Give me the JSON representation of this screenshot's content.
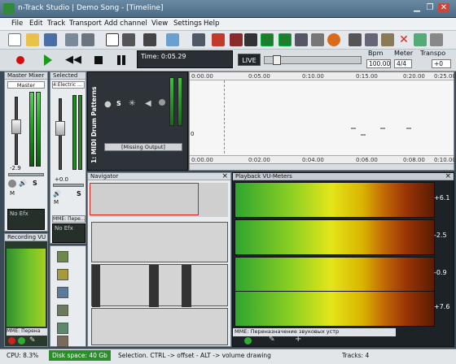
{
  "app": {
    "title": "n-Track Studio | Demo Song - [Timeline]"
  },
  "menu": [
    "File",
    "Edit",
    "Track",
    "Transport",
    "Add channel",
    "View",
    "Settings",
    "Help"
  ],
  "toolbar": {
    "bpm_label": "Bpm",
    "meter_label": "Meter",
    "transport_label": "Transpo",
    "bpm_value": "100.00",
    "meter_value": "4/4",
    "transport_value": "+0"
  },
  "transport_bar": {
    "time": "Time: 0:05.29",
    "live": "LIVE"
  },
  "master_mixer": {
    "title": "Master Mixer",
    "channel": "Master",
    "db": "-2.9",
    "mute": "M",
    "solo": "S",
    "fx": "No Efx",
    "meter_label": "Recording VU"
  },
  "selected_track": {
    "title": "Selected",
    "channel": "4:Electric ...",
    "db": "+0.0",
    "mute": "M",
    "solo": "S",
    "fx": "No Efx",
    "device": "MME: Пере..."
  },
  "track_header": {
    "name": "1: MIDI Drum Patterns",
    "missing": "[Missing Output]",
    "solo": "S"
  },
  "ruler": {
    "marks": [
      "0:00.00",
      "0:05.00",
      "0:10.00",
      "0:15.00",
      "0:20.00",
      "0:25.00"
    ],
    "bottom_marks": [
      "0:00.00",
      "0:02.00",
      "0:04.00",
      "0:06.00",
      "0:08.00",
      "0:10.00"
    ],
    "zero": "0"
  },
  "navigator": {
    "title": "Navigator"
  },
  "playback_vu": {
    "title": "Playback VU-Meters",
    "rows": [
      {
        "label": "+6.1"
      },
      {
        "label": "-2.5"
      },
      {
        "label": "-0.9"
      },
      {
        "label": "+7.6"
      }
    ],
    "device": "MME: Переназначение звуковых устр"
  },
  "recording_vu": {
    "device": "MME: Перена"
  },
  "status": {
    "cpu": "CPU: 8.3%",
    "disk": "Disk space: 40 Gb",
    "hint": "Selection. CTRL -> offset - ALT -> volume drawing",
    "tracks": "Tracks: 4"
  },
  "colors": {
    "title_bar": "#4c6a84",
    "live_bg": "#1f262c",
    "vu_green": "#2ea52e",
    "vu_red": "#9a3405",
    "record_red": "#d01010",
    "play_green": "#1a9a1a"
  }
}
